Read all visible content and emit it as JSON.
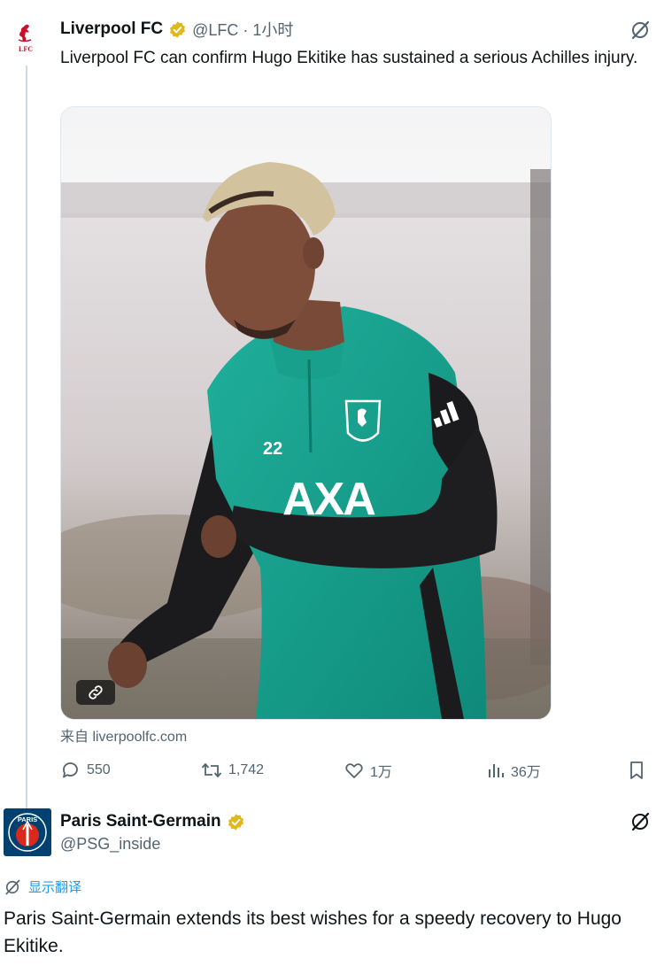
{
  "tweet1": {
    "author_name": "Liverpool FC",
    "handle_time": "@LFC · 1小时",
    "avatar_logo": "LFC",
    "text": "Liverpool FC can confirm Hugo Ekitike has sustained a serious Achilles injury.",
    "media": {
      "shirt_number": "22",
      "sponsor": "AXA",
      "link_icon": "link-icon"
    },
    "source": "来自 liverpoolfc.com",
    "actions": {
      "replies": "550",
      "reposts": "1,742",
      "likes": "1万",
      "views": "36万"
    },
    "icons": [
      "verified-badge-icon",
      "grok-icon",
      "reply-icon",
      "repost-icon",
      "like-icon",
      "views-icon",
      "bookmark-icon"
    ]
  },
  "tweet2": {
    "author_name": "Paris Saint-Germain",
    "handle": "@PSG_inside",
    "avatar_logo": "PARIS",
    "translate_label": "显示翻译",
    "text": "Paris Saint-Germain extends its best wishes for a speedy recovery to Hugo Ekitike."
  },
  "colors": {
    "verified_gold": "#e2b719",
    "psg_navy": "#004170",
    "psg_red": "#da291c",
    "lfc_red": "#c8102e",
    "link_blue": "#1d9bf0",
    "secondary_text": "#536471",
    "kit_teal": "#179c8a"
  }
}
